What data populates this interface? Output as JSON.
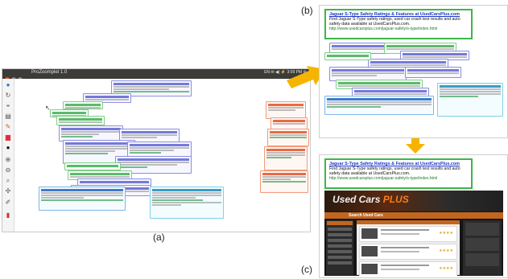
{
  "labels": {
    "a": "(a)",
    "b": "(b)",
    "c": "(c)"
  },
  "window": {
    "title": "ProZoomplet 1.0",
    "status": "EN  ✉  ◀)  ⚡  3:09 PM  ⚙"
  },
  "featured": {
    "title": "Jaguar S-Type Safety Ratings & Features at UsedCarsPlus.com",
    "description": "Find Jaguar S-Type safety ratings, used car crash test results and auto safety data available at UsedCarsPlus.com.",
    "url": "http://www.usedcarsplus.com/jaguar-safety/s-type/index.html"
  },
  "site": {
    "logo_main": "Used Cars",
    "logo_plus": "PLUS",
    "search_label": "Search Used Cars",
    "stars": "★★★★"
  },
  "colors": {
    "featured_border": "#3fb54a",
    "arrow": "#f5b400",
    "card_blue": "#8b8fe0",
    "card_green": "#7fcf8a",
    "card_orange": "#f19a7a",
    "card_cyan": "#7fd1e6"
  },
  "tool_icons": [
    "globe-icon",
    "refresh-icon",
    "pin-icon",
    "stack-icon",
    "paint-icon",
    "palette-icon",
    "circle-icon",
    "zoom-in-icon",
    "zoom-out-icon",
    "fit-icon",
    "settings-icon",
    "pen-icon",
    "trash-icon"
  ]
}
